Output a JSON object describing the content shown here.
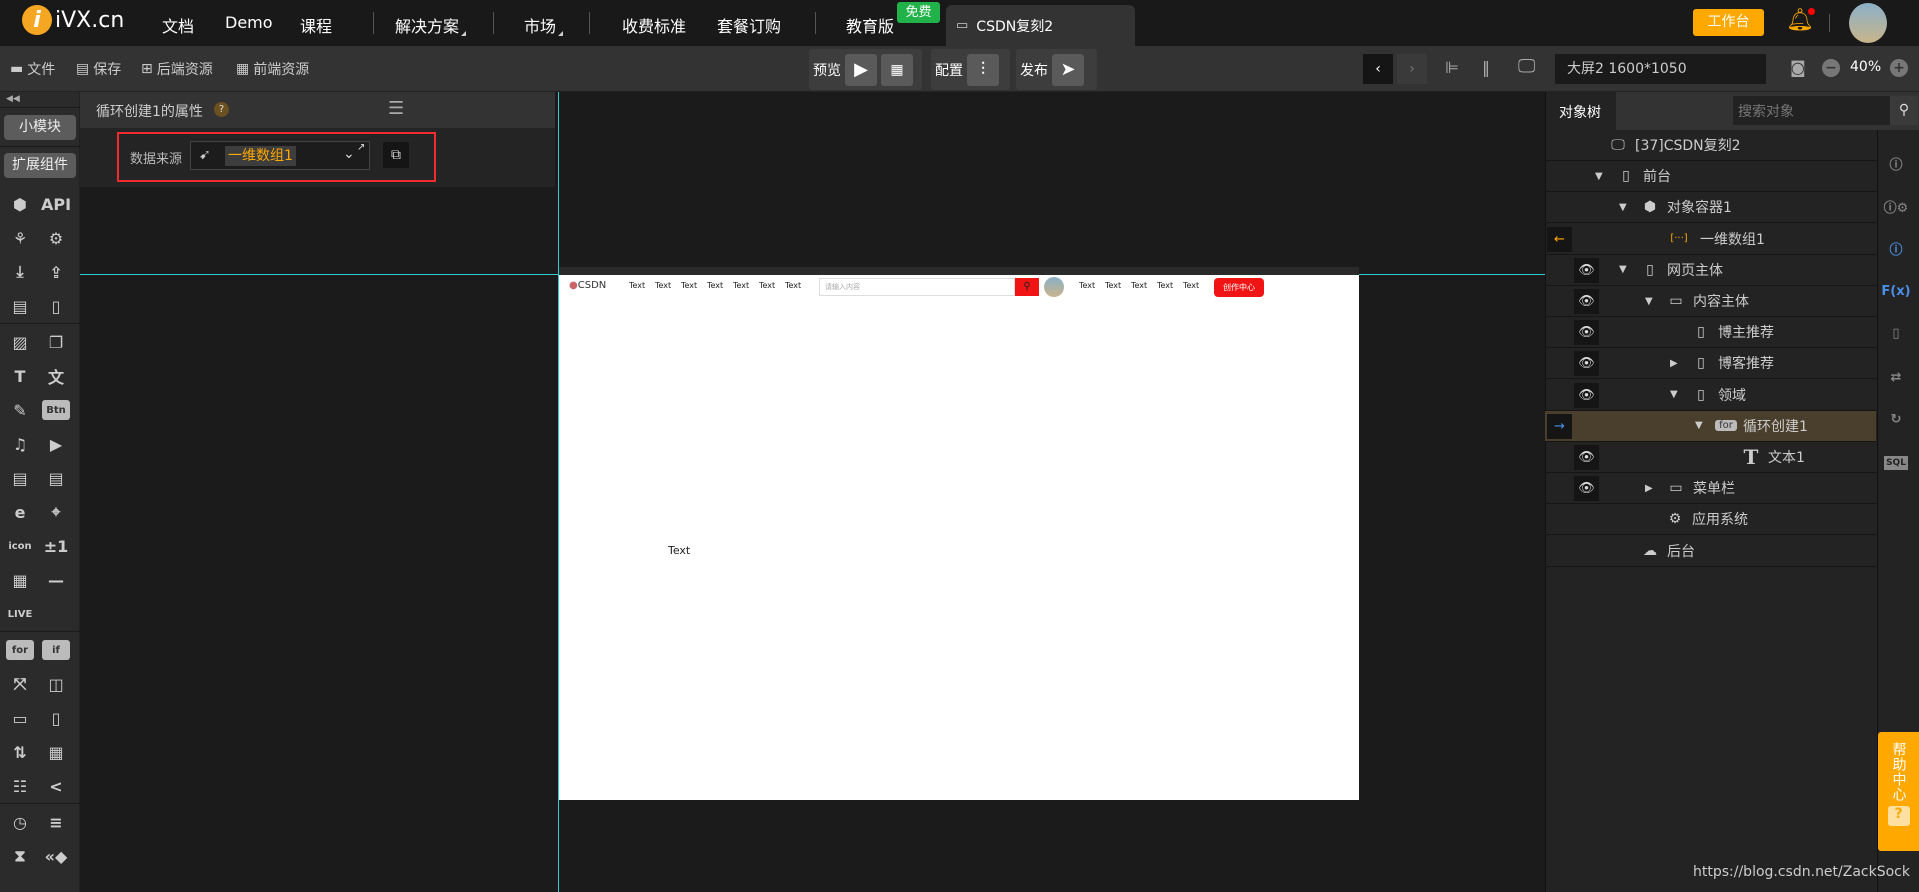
{
  "topbar": {
    "logo": "iVX.cn",
    "nav": [
      "文档",
      "Demo",
      "课程",
      "解决方案",
      "市场",
      "收费标准",
      "套餐订购",
      "教育版"
    ],
    "free_badge": "免费",
    "tab": "CSDN复刻2",
    "workbench": "工作台"
  },
  "toolbar": {
    "file": "文件",
    "save": "保存",
    "backend": "后端资源",
    "frontend": "前端资源",
    "preview": "预览",
    "config": "配置",
    "publish": "发布",
    "screen": "大屏2 1600*1050",
    "zoom": "40%"
  },
  "leftbar": {
    "small_module": "小模块",
    "ext": "扩展组件",
    "icons": [
      [
        "box-icon",
        "API"
      ],
      [
        "network-icon",
        "gear-icon"
      ],
      [
        "download-icon",
        "upload-icon"
      ],
      [
        "layout-icon",
        "device-icon"
      ],
      [
        "image-icon",
        "images-icon"
      ],
      [
        "text-icon",
        "translate-icon"
      ],
      [
        "edit-icon",
        "Btn"
      ],
      [
        "music-icon",
        "video-icon"
      ],
      [
        "richtext-icon",
        "richtext2-icon"
      ],
      [
        "ie-icon",
        "map-icon"
      ],
      [
        "icon",
        "±1"
      ],
      [
        "qr-icon",
        "line-icon"
      ],
      [
        "LIVE"
      ],
      [
        "for",
        "if"
      ],
      [
        "fullscreen-icon",
        "layer-icon"
      ],
      [
        "hrow-icon",
        "vcol-icon"
      ],
      [
        "sort-icon",
        "table-icon"
      ],
      [
        "tree-icon",
        "share-icon"
      ],
      [
        "timer-icon",
        "sliders-icon"
      ],
      [
        "hourglass-icon",
        "rewind-icon"
      ]
    ]
  },
  "props": {
    "title": "循环创建1的属性",
    "help": "?",
    "datasource_label": "数据来源",
    "datasource_value": "一维数组1"
  },
  "canvas": {
    "brand": "CSDN",
    "nav_left": [
      "Text",
      "Text",
      "Text",
      "Text",
      "Text",
      "Text",
      "Text"
    ],
    "search_placeholder": "请输入内容",
    "nav_right": [
      "Text",
      "Text",
      "Text",
      "Text",
      "Text"
    ],
    "create_btn": "创作中心",
    "text1": "Text"
  },
  "tree": {
    "tab": "对象树",
    "search_placeholder": "搜索对象",
    "rows": [
      {
        "label": "[37]CSDN复刻2",
        "icon": "app-icon"
      },
      {
        "label": "前台",
        "icon": "phone-icon"
      },
      {
        "label": "对象容器1",
        "icon": "box-icon"
      },
      {
        "label": "一维数组1",
        "icon": "array-icon"
      },
      {
        "label": "网页主体",
        "icon": "vcol-icon"
      },
      {
        "label": "内容主体",
        "icon": "hrow-icon"
      },
      {
        "label": "博主推荐",
        "icon": "vcol-icon"
      },
      {
        "label": "博客推荐",
        "icon": "vcol-icon"
      },
      {
        "label": "领域",
        "icon": "vcol-icon"
      },
      {
        "label": "循环创建1",
        "icon": "for-icon"
      },
      {
        "label": "文本1",
        "icon": "text-icon"
      },
      {
        "label": "菜单栏",
        "icon": "hrow-icon"
      },
      {
        "label": "应用系统",
        "icon": "gear-icon"
      },
      {
        "label": "后台",
        "icon": "server-icon"
      }
    ]
  },
  "help": {
    "label": "帮助中心",
    "q": "?"
  },
  "watermark": "https://blog.csdn.net/ZackSock",
  "colors": {
    "accent": "#ffa800",
    "free": "#21b24a",
    "selected_row": "#4a3f2c",
    "red": "#f12c2c"
  }
}
